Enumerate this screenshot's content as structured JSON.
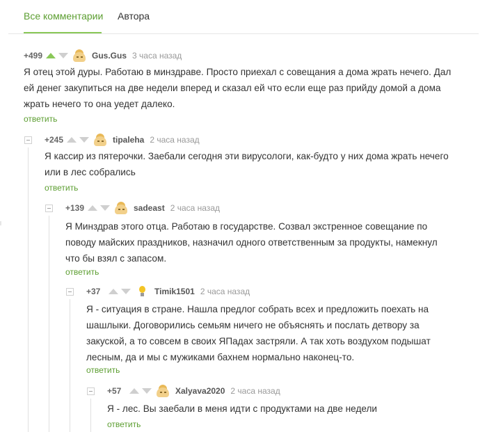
{
  "tabs": {
    "all_comments": "Все комментарии",
    "author": "Автора"
  },
  "colors": {
    "accent": "#8ac858",
    "link": "#5c9e31",
    "text": "#333333",
    "muted": "#999999"
  },
  "comments": [
    {
      "rating": "+499",
      "user": "Gus.Gus",
      "time": "3 часа назад",
      "upvoted": true,
      "avatar": "avatar-icon",
      "lines": [
        "Я отец этой дуры. Работаю в минздраве. Просто приехал с совещания а дома жрать нечего. Дал",
        "ей денег закупиться на две недели вперед и сказал ей что если еще раз прийду домой а дома",
        "жрать нечего то она уедет далеко."
      ],
      "reply": "ответить"
    },
    {
      "rating": "+245",
      "user": "tipaleha",
      "time": "2 часа назад",
      "upvoted": false,
      "avatar": "avatar-icon",
      "lines": [
        "Я кассир из пятерочки. Заебали сегодня эти вирусологи, как-будто у них дома жрать нечего",
        "или в лес собрались"
      ],
      "reply": "ответить"
    },
    {
      "rating": "+139",
      "user": "sadeast",
      "time": "2 часа назад",
      "upvoted": false,
      "avatar": "avatar-icon",
      "lines": [
        "Я Минздрав этого отца. Работаю в государстве. Созвал экстренное совещание по",
        "поводу майских праздников, назначил одного ответственным за продукты, намекнул",
        "что бы взял с запасом."
      ],
      "reply": "ответить"
    },
    {
      "rating": "+37",
      "user": "Timik1501",
      "time": "2 часа назад",
      "upvoted": false,
      "avatar": "lightbulb-icon",
      "lines": [
        "Я - ситуация в стране. Нашла предлог собрать всех и предложить поехать на",
        "шашлыки. Договорились семьям ничего не объяснять и послать детвору за",
        "закуской, а то совсем в своих ЯПадах застряли. А так хоть воздухом подышат",
        "лесным, да и мы с мужиками бахнем нормально наконец-то."
      ],
      "reply": "ответить"
    },
    {
      "rating": "+57",
      "user": "Xalyava2020",
      "time": "2 часа назад",
      "upvoted": false,
      "avatar": "avatar-icon",
      "lines": [
        "Я - лес. Вы заебали в меня идти с продуктами на две недели"
      ],
      "reply": "ответить"
    }
  ]
}
